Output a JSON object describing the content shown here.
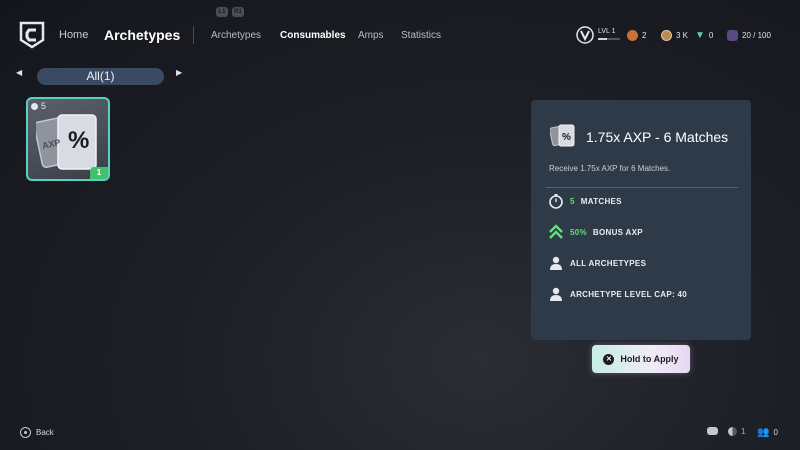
{
  "header": {
    "nav_home": "Home",
    "nav_title": "Archetypes",
    "kbd_left": "L1",
    "kbd_right": "R1",
    "tabs": [
      {
        "label": "Archetypes",
        "active": false
      },
      {
        "label": "Consumables",
        "active": true
      },
      {
        "label": "Amps",
        "active": false
      },
      {
        "label": "Statistics",
        "active": false
      }
    ],
    "level": "LVL 1",
    "level_progress": 0.4,
    "currency_a": "2",
    "currency_b": "3 K",
    "currency_c": "0",
    "capacity": "20 / 100"
  },
  "filter": {
    "label": "All(1)",
    "prev_arrow": "◀",
    "next_arrow": "▶"
  },
  "item_card": {
    "count": "5",
    "quantity": "1",
    "front_symbol": "%",
    "back_text": "AXP"
  },
  "detail": {
    "title": "1.75x AXP - 6 Matches",
    "description": "Receive 1.75x AXP for 6 Matches.",
    "rows": [
      {
        "highlight": "5",
        "text": "MATCHES",
        "icon": "stopwatch-icon"
      },
      {
        "highlight": "50%",
        "text": "BONUS AXP",
        "icon": "double-chevron-up-icon"
      },
      {
        "highlight": "",
        "text": "ALL ARCHETYPES",
        "icon": "person-icon"
      },
      {
        "highlight": "",
        "text": "ARCHETYPE LEVEL CAP: 40",
        "icon": "person-icon"
      }
    ]
  },
  "apply_button": {
    "label": "Hold to Apply",
    "button_glyph": "✕"
  },
  "footer": {
    "back_label": "Back",
    "count_green": "1",
    "count_players": "0"
  },
  "colors": {
    "accent_green": "#5ee07a",
    "card_border": "#58d1c0",
    "panel_bg": "#2f3a49",
    "filter_bg": "#3a4a63"
  }
}
